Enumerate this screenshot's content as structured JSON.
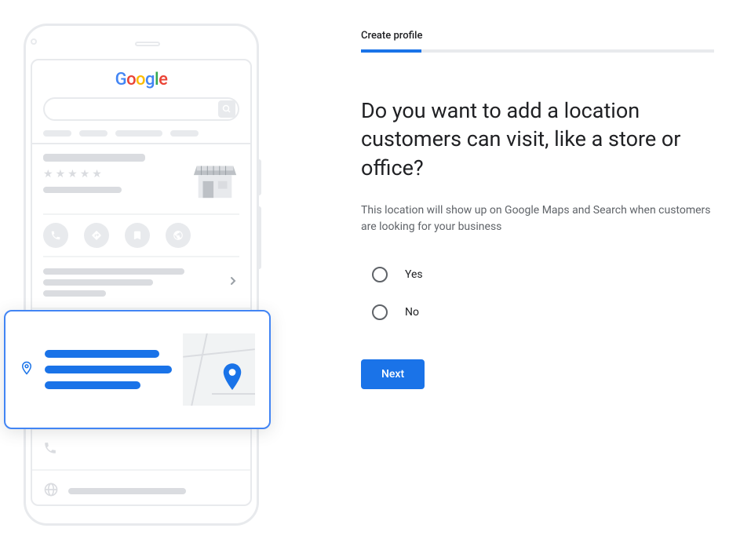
{
  "step": {
    "label": "Create profile",
    "progress_percent": 17
  },
  "question": {
    "heading": "Do you want to add a location customers can visit, like a store or office?",
    "subtext": "This location will show up on Google Maps and Search when customers are looking for your business"
  },
  "options": {
    "yes": "Yes",
    "no": "No"
  },
  "buttons": {
    "next": "Next"
  },
  "illustration": {
    "logo_letters": [
      "G",
      "o",
      "o",
      "g",
      "l",
      "e"
    ]
  }
}
